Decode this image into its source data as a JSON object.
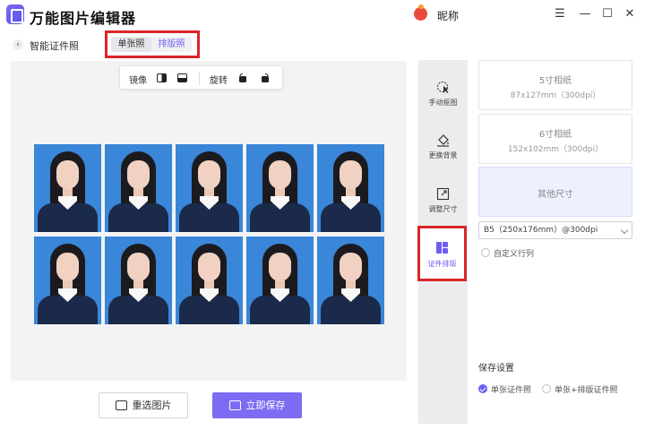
{
  "app": {
    "title": "万能图片编辑器",
    "nickname": "昵称"
  },
  "window_controls": {
    "settings": "☰",
    "minimize": "—",
    "maximize": "☐",
    "close": "✕"
  },
  "header": {
    "page_title": "智能证件照",
    "tabs": [
      {
        "label": "单张照",
        "active": true
      },
      {
        "label": "排版照",
        "active": false
      }
    ]
  },
  "toolbar": {
    "mirror_label": "镜像",
    "rotate_label": "旋转"
  },
  "preview": {
    "layout_rows": 2,
    "layout_cols": 5,
    "background_color": "#3a86d8"
  },
  "actions": {
    "reselect_label": "重选图片",
    "save_label": "立即保存"
  },
  "rail": {
    "items": [
      {
        "label": "手动抠图",
        "icon": "cursor-icon"
      },
      {
        "label": "更换背景",
        "icon": "paint-bucket-icon"
      },
      {
        "label": "调整尺寸",
        "icon": "resize-icon"
      },
      {
        "label": "证件排版",
        "icon": "layout-grid-icon",
        "active": true
      }
    ]
  },
  "sizes": [
    {
      "name": "5寸相纸",
      "spec": "87x127mm（300dpi）"
    },
    {
      "name": "6寸相纸",
      "spec": "152x102mm（300dpi）"
    },
    {
      "name": "其他尺寸",
      "spec": "",
      "selected": true
    }
  ],
  "paper_select": {
    "value": "B5（250x176mm）@300dpi"
  },
  "custom_rows": {
    "label": "自定义行列",
    "checked": false
  },
  "save_settings": {
    "title": "保存设置",
    "options": [
      {
        "label": "单张证件照",
        "checked": true
      },
      {
        "label": "单张+排版证件照",
        "checked": false
      }
    ]
  },
  "colors": {
    "accent": "#7c6cf3",
    "highlight": "#d9252a",
    "photo_bg": "#3a86d8"
  }
}
